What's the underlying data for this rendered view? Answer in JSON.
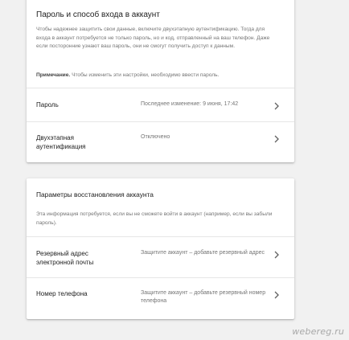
{
  "security_card": {
    "title": "Пароль и способ входа в аккаунт",
    "description": "Чтобы надежнее защитить свои данные, включите двухэтапную аутентификацию. Тогда для входа в аккаунт потребуется не только пароль, но и код, отправленный на ваш телефон. Даже если посторонние узнают ваш пароль, они не смогут получить доступ к данным.",
    "note_label": "Примечание.",
    "note_text": " Чтобы изменить эти настройки, необходимо ввести пароль.",
    "rows": [
      {
        "label": "Пароль",
        "value": "Последнее изменение: 9 июня, 17:42"
      },
      {
        "label": "Двухэтапная аутентификация",
        "value": "Отключено"
      }
    ]
  },
  "recovery_card": {
    "title": "Параметры восстановления аккаунта",
    "description": "Эта информация потребуется, если вы не сможете войти в аккаунт (например, если вы забыли пароль).",
    "rows": [
      {
        "label": "Резервный адрес электронной почты",
        "value": "Защитите аккаунт – добавьте резервный адрес"
      },
      {
        "label": "Номер телефона",
        "value": "Защитите аккаунт – добавьте резервный номер телефона"
      }
    ]
  },
  "icons": {
    "row_arrow": "chevron-right-icon"
  },
  "colors": {
    "card_bg": "#ffffff",
    "page_bg": "#f1f1f1",
    "muted_text": "#757575"
  },
  "watermark": "webereg.ru"
}
